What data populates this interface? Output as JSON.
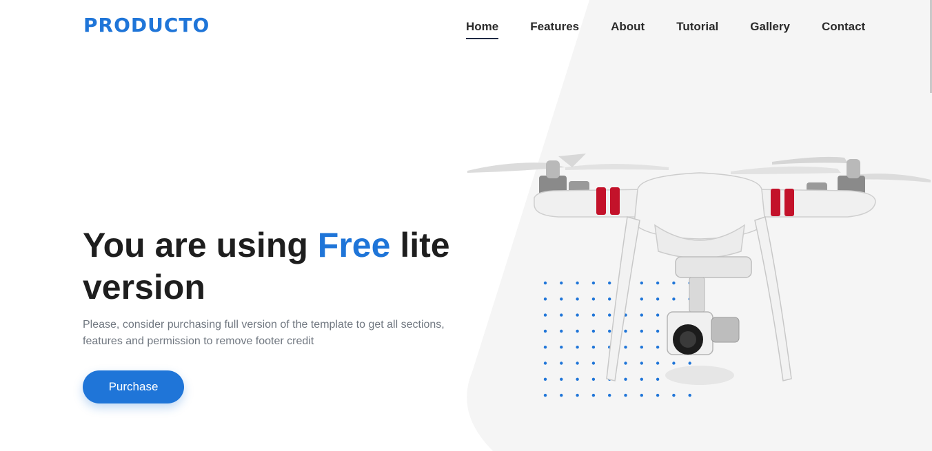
{
  "brand": {
    "name": "PRODUCTO"
  },
  "nav": {
    "items": [
      {
        "label": "Home",
        "active": true
      },
      {
        "label": "Features",
        "active": false
      },
      {
        "label": "About",
        "active": false
      },
      {
        "label": "Tutorial",
        "active": false
      },
      {
        "label": "Gallery",
        "active": false
      },
      {
        "label": "Contact",
        "active": false
      }
    ]
  },
  "hero": {
    "title_part1": "You are using ",
    "title_highlight": "Free",
    "title_part2": " lite version",
    "description": "Please, consider purchasing full version of the template to get all sections, features and permission to remove footer credit",
    "button_label": "Purchase",
    "image_icon": "drone-icon"
  },
  "colors": {
    "accent": "#1f75d8",
    "text_dark": "#1e1e1e",
    "text_muted": "#707780",
    "panel_bg": "#f5f5f5"
  }
}
